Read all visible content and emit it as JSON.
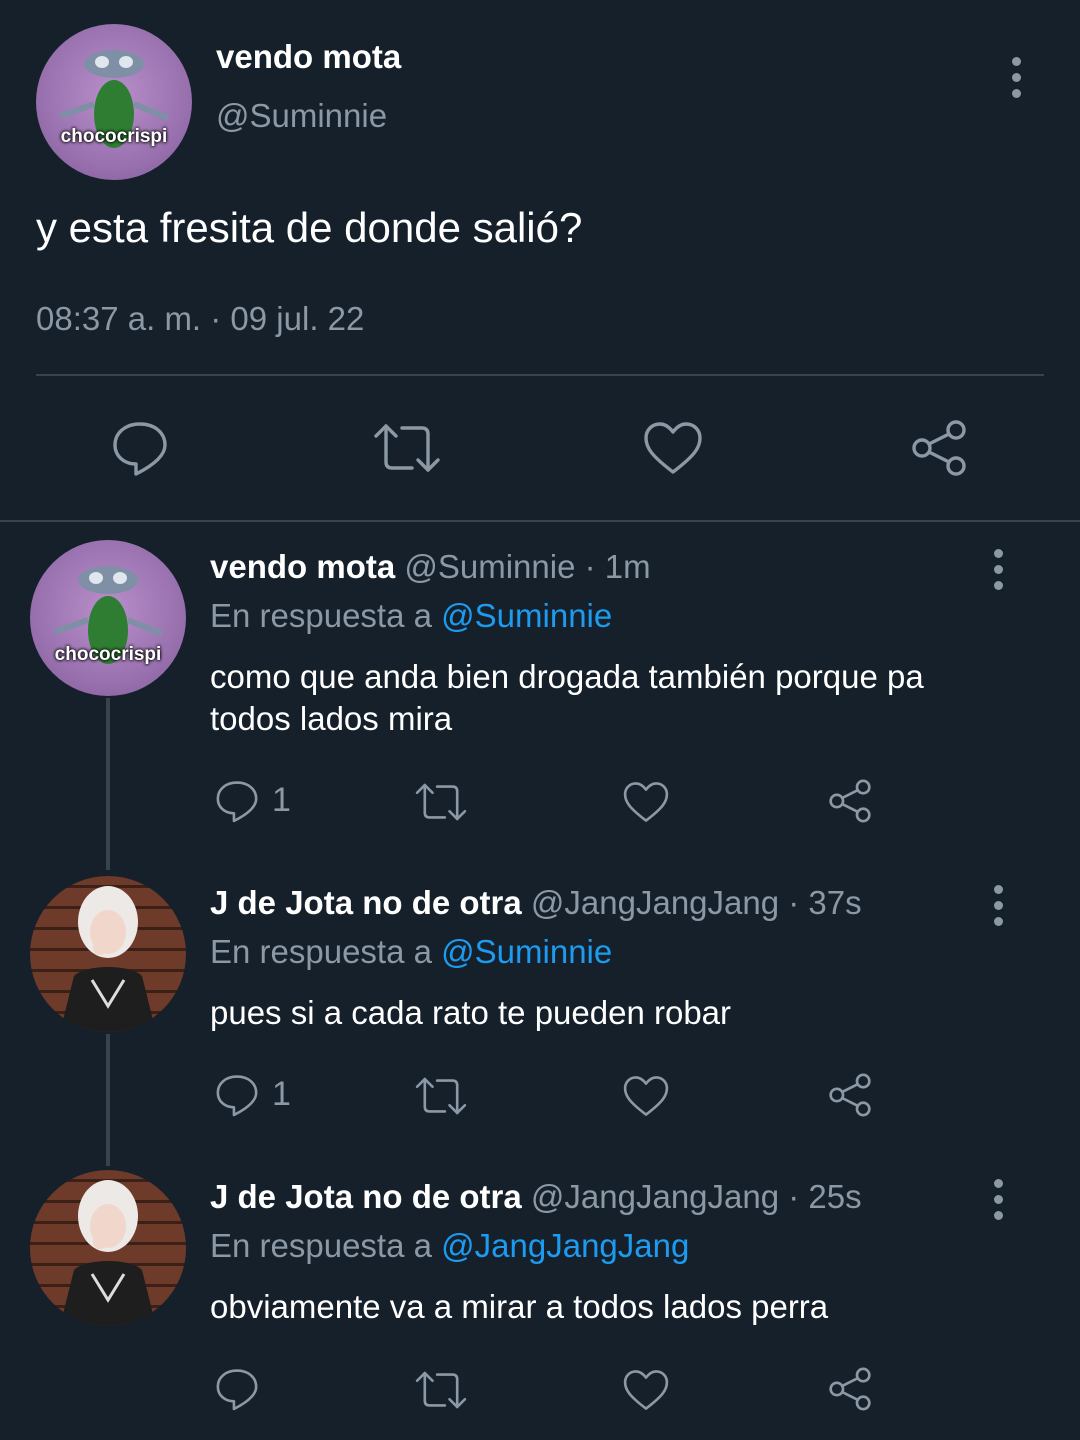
{
  "main_tweet": {
    "display_name": "vendo mota",
    "handle": "@Suminnie",
    "avatar_caption": "chococrispi",
    "text": "y esta fresita de donde salió?",
    "timestamp": "08:37 a. m. · 09 jul. 22"
  },
  "replies": [
    {
      "display_name": "vendo mota",
      "meta": "@Suminnie · 1m",
      "reply_prefix": "En respuesta a",
      "reply_to": "@Suminnie",
      "text": "como que anda bien drogada también porque pa todos lados mira",
      "reply_count": "1",
      "avatar_caption": "chococrispi"
    },
    {
      "display_name": "J de Jota no de otra",
      "meta": "@JangJangJang · 37s",
      "reply_prefix": "En respuesta a",
      "reply_to": "@Suminnie",
      "text": "pues si a cada rato te pueden robar",
      "reply_count": "1"
    },
    {
      "display_name": "J de Jota no de otra",
      "meta": "@JangJangJang · 25s",
      "reply_prefix": "En respuesta a",
      "reply_to": "@JangJangJang",
      "text": "obviamente va a mirar a todos lados perra",
      "reply_count": ""
    }
  ],
  "colors": {
    "background": "#15202b",
    "muted": "#8b98a5",
    "link": "#1d9bf0",
    "divider": "#38444d"
  }
}
